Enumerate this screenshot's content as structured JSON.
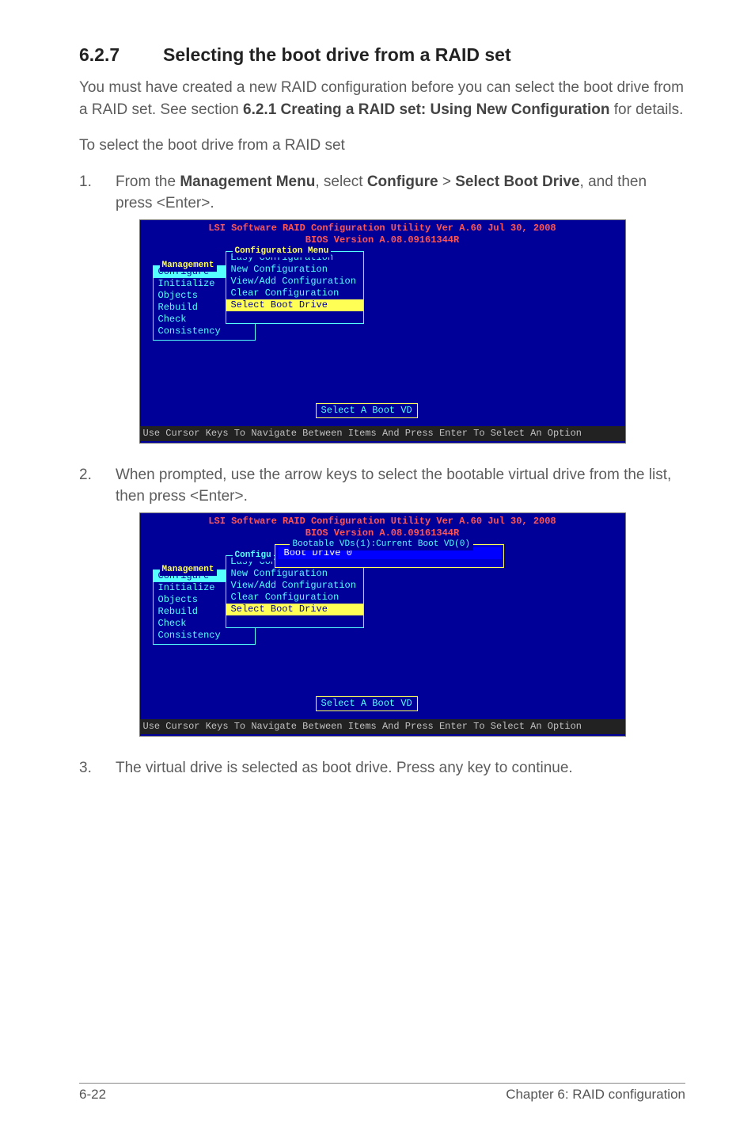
{
  "heading": {
    "num": "6.2.7",
    "title": "Selecting the boot drive from a RAID set"
  },
  "intro1": "You must have created a new RAID configuration before you can select the boot drive from a RAID set. See section ",
  "intro1b": "6.2.1 Creating a RAID set: Using New Configuration",
  "intro1c": " for details.",
  "intro2": "To select the boot drive from a RAID set",
  "step1n": "1.",
  "step1a": "From the ",
  "step1b": "Management Menu",
  "step1c": ", select ",
  "step1d": "Configure",
  "step1e": " > ",
  "step1f": "Select Boot Drive",
  "step1g": ", and then press <Enter>.",
  "step2n": "2.",
  "step2": "When prompted, use the arrow keys to select the bootable virtual drive from the list, then press <Enter>.",
  "step3n": "3.",
  "step3": "The virtual drive is selected as boot drive. Press any key to continue.",
  "bios": {
    "hdr1": "LSI Software RAID Configuration Utility Ver A.60 Jul 30, 2008",
    "hdr2": "BIOS Version   A.08.09161344R",
    "mgmt_title": "Management",
    "mgmt_items": [
      "Configure",
      "Initialize",
      "Objects",
      "Rebuild",
      "Check Consistency"
    ],
    "cmenu_title": "Configuration Menu",
    "cmenu_items": [
      "Easy Configuration",
      "New Configuration",
      "View/Add Configuration",
      "Clear Configuration",
      "Select Boot Drive"
    ],
    "configu": "Configu",
    "easycon": "Easy Con",
    "boot_title": "Bootable VDs(1):Current Boot VD(0)",
    "boot_row": "Boot Drive 0",
    "selvd": "Select A Boot VD",
    "footer": "Use Cursor Keys To Navigate Between Items And Press Enter To Select An Option"
  },
  "footer": {
    "left": "6-22",
    "right": "Chapter 6: RAID configuration"
  }
}
